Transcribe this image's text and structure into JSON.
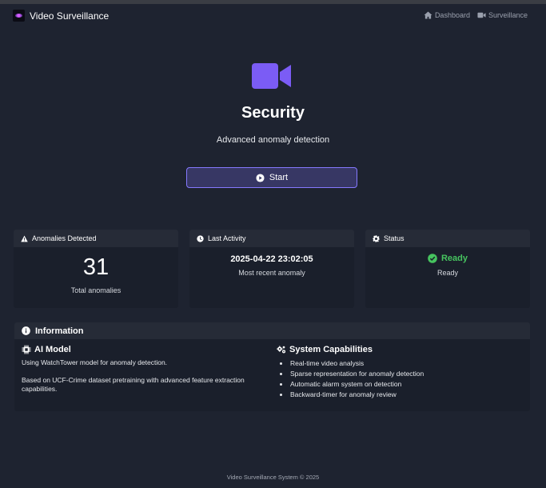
{
  "navbar": {
    "brand": "Video Surveillance",
    "links": [
      {
        "label": "Dashboard",
        "icon": "home-icon"
      },
      {
        "label": "Surveillance",
        "icon": "video-camera-icon"
      }
    ]
  },
  "hero": {
    "icon": "video-camera-icon",
    "title": "Security",
    "subtitle": "Advanced anomaly detection",
    "start_label": "Start"
  },
  "cards": {
    "anomalies": {
      "header": "Anomalies Detected",
      "icon": "warning-icon",
      "value": "31",
      "caption": "Total anomalies"
    },
    "activity": {
      "header": "Last Activity",
      "icon": "clock-icon",
      "value": "2025-04-22 23:02:05",
      "caption": "Most recent anomaly"
    },
    "status": {
      "header": "Status",
      "icon": "gear-icon",
      "value": "Ready",
      "caption": "Ready",
      "color": "#46c35f"
    }
  },
  "info": {
    "header": "Information",
    "ai_model": {
      "title": "AI Model",
      "line1": "Using WatchTower model for anomaly detection.",
      "line2": "Based on UCF-Crime dataset pretraining with advanced feature extraction capabilities."
    },
    "capabilities": {
      "title": "System Capabilities",
      "items": [
        "Real-time video analysis",
        "Sparse representation for anomaly detection",
        "Automatic alarm system on detection",
        "Backward-timer for anomaly review"
      ]
    }
  },
  "footer": "Video Surveillance System © 2025",
  "colors": {
    "background": "#1e2330",
    "accent": "#7b5cf5",
    "success": "#46c35f"
  }
}
